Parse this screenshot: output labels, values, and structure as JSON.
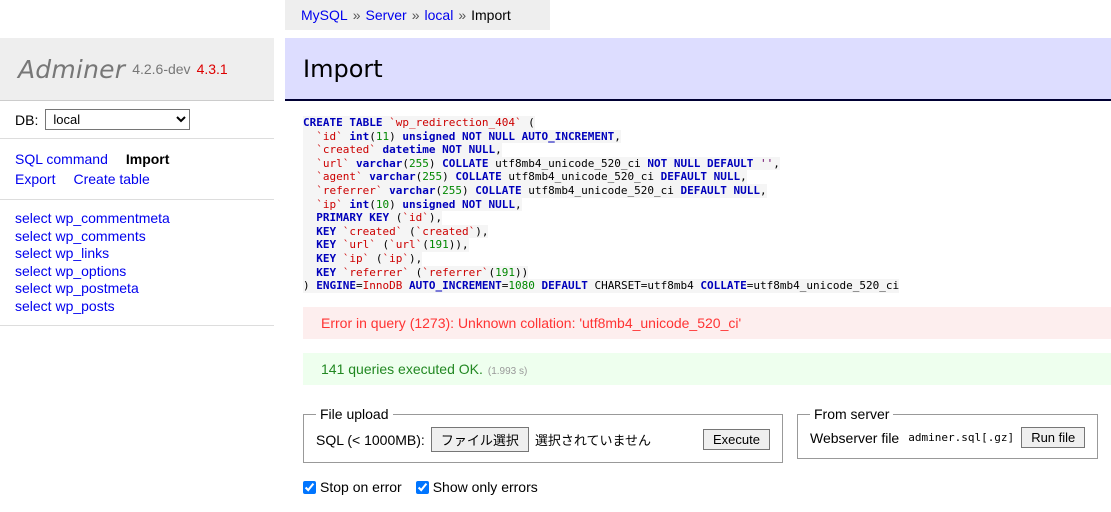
{
  "breadcrumb": {
    "separator": "»",
    "items": [
      {
        "label": "MySQL",
        "link": true
      },
      {
        "label": "Server",
        "link": true
      },
      {
        "label": "local",
        "link": true
      },
      {
        "label": "Import",
        "link": false
      }
    ]
  },
  "sidebar": {
    "logo": {
      "name": "Adminer",
      "version": "4.2.6-dev",
      "new_version": "4.3.1"
    },
    "db": {
      "label": "DB:",
      "selected": "local",
      "options": [
        "local"
      ]
    },
    "nav": {
      "row1": [
        {
          "label": "SQL command",
          "current": false
        },
        {
          "label": "Import",
          "current": true
        }
      ],
      "row2": [
        {
          "label": "Export",
          "current": false
        },
        {
          "label": "Create table",
          "current": false
        }
      ]
    },
    "tables": [
      "select wp_commentmeta",
      "select wp_comments",
      "select wp_links",
      "select wp_options",
      "select wp_postmeta",
      "select wp_posts"
    ]
  },
  "main": {
    "title": "Import",
    "sql": {
      "raw": "CREATE TABLE `wp_redirection_404` (\n  `id` int(11) unsigned NOT NULL AUTO_INCREMENT,\n  `created` datetime NOT NULL,\n  `url` varchar(255) COLLATE utf8mb4_unicode_520_ci NOT NULL DEFAULT '',\n  `agent` varchar(255) COLLATE utf8mb4_unicode_520_ci DEFAULT NULL,\n  `referrer` varchar(255) COLLATE utf8mb4_unicode_520_ci DEFAULT NULL,\n  `ip` int(10) unsigned NOT NULL,\n  PRIMARY KEY (`id`),\n  KEY `created` (`created`),\n  KEY `url` (`url`(191)),\n  KEY `ip` (`ip`),\n  KEY `referrer` (`referrer`(191))\n) ENGINE=InnoDB AUTO_INCREMENT=1080 DEFAULT CHARSET=utf8mb4 COLLATE=utf8mb4_unicode_520_ci",
      "lines": [
        [
          [
            "k",
            "CREATE TABLE"
          ],
          [
            "pl",
            " "
          ],
          [
            "id",
            "`wp_redirection_404`"
          ],
          [
            "pl",
            " ("
          ]
        ],
        [
          [
            "pl",
            "  "
          ],
          [
            "id",
            "`id`"
          ],
          [
            "pl",
            " "
          ],
          [
            "k",
            "int"
          ],
          [
            "pl",
            "("
          ],
          [
            "num",
            "11"
          ],
          [
            "pl",
            ") "
          ],
          [
            "k",
            "unsigned NOT NULL AUTO_INCREMENT"
          ],
          [
            "pl",
            ","
          ]
        ],
        [
          [
            "pl",
            "  "
          ],
          [
            "id",
            "`created`"
          ],
          [
            "pl",
            " "
          ],
          [
            "k",
            "datetime NOT NULL"
          ],
          [
            "pl",
            ","
          ]
        ],
        [
          [
            "pl",
            "  "
          ],
          [
            "id",
            "`url`"
          ],
          [
            "pl",
            " "
          ],
          [
            "k",
            "varchar"
          ],
          [
            "pl",
            "("
          ],
          [
            "num",
            "255"
          ],
          [
            "pl",
            ") "
          ],
          [
            "k",
            "COLLATE"
          ],
          [
            "pl",
            " utf8mb4_unicode_520_ci "
          ],
          [
            "k",
            "NOT NULL DEFAULT"
          ],
          [
            "pl",
            " "
          ],
          [
            "str",
            "''"
          ],
          [
            "pl",
            ","
          ]
        ],
        [
          [
            "pl",
            "  "
          ],
          [
            "id",
            "`agent`"
          ],
          [
            "pl",
            " "
          ],
          [
            "k",
            "varchar"
          ],
          [
            "pl",
            "("
          ],
          [
            "num",
            "255"
          ],
          [
            "pl",
            ") "
          ],
          [
            "k",
            "COLLATE"
          ],
          [
            "pl",
            " utf8mb4_unicode_520_ci "
          ],
          [
            "k",
            "DEFAULT NULL"
          ],
          [
            "pl",
            ","
          ]
        ],
        [
          [
            "pl",
            "  "
          ],
          [
            "id",
            "`referrer`"
          ],
          [
            "pl",
            " "
          ],
          [
            "k",
            "varchar"
          ],
          [
            "pl",
            "("
          ],
          [
            "num",
            "255"
          ],
          [
            "pl",
            ") "
          ],
          [
            "k",
            "COLLATE"
          ],
          [
            "pl",
            " utf8mb4_unicode_520_ci "
          ],
          [
            "k",
            "DEFAULT NULL"
          ],
          [
            "pl",
            ","
          ]
        ],
        [
          [
            "pl",
            "  "
          ],
          [
            "id",
            "`ip`"
          ],
          [
            "pl",
            " "
          ],
          [
            "k",
            "int"
          ],
          [
            "pl",
            "("
          ],
          [
            "num",
            "10"
          ],
          [
            "pl",
            ") "
          ],
          [
            "k",
            "unsigned NOT NULL"
          ],
          [
            "pl",
            ","
          ]
        ],
        [
          [
            "pl",
            "  "
          ],
          [
            "k",
            "PRIMARY KEY"
          ],
          [
            "pl",
            " ("
          ],
          [
            "id",
            "`id`"
          ],
          [
            "pl",
            "),"
          ]
        ],
        [
          [
            "pl",
            "  "
          ],
          [
            "k",
            "KEY"
          ],
          [
            "pl",
            " "
          ],
          [
            "id",
            "`created`"
          ],
          [
            "pl",
            " ("
          ],
          [
            "id",
            "`created`"
          ],
          [
            "pl",
            "),"
          ]
        ],
        [
          [
            "pl",
            "  "
          ],
          [
            "k",
            "KEY"
          ],
          [
            "pl",
            " "
          ],
          [
            "id",
            "`url`"
          ],
          [
            "pl",
            " ("
          ],
          [
            "id",
            "`url`"
          ],
          [
            "pl",
            "("
          ],
          [
            "num",
            "191"
          ],
          [
            "pl",
            ")),"
          ]
        ],
        [
          [
            "pl",
            "  "
          ],
          [
            "k",
            "KEY"
          ],
          [
            "pl",
            " "
          ],
          [
            "id",
            "`ip`"
          ],
          [
            "pl",
            " ("
          ],
          [
            "id",
            "`ip`"
          ],
          [
            "pl",
            "),"
          ]
        ],
        [
          [
            "pl",
            "  "
          ],
          [
            "k",
            "KEY"
          ],
          [
            "pl",
            " "
          ],
          [
            "id",
            "`referrer`"
          ],
          [
            "pl",
            " ("
          ],
          [
            "id",
            "`referrer`"
          ],
          [
            "pl",
            "("
          ],
          [
            "num",
            "191"
          ],
          [
            "pl",
            "))"
          ]
        ],
        [
          [
            "pl",
            ") "
          ],
          [
            "k",
            "ENGINE"
          ],
          [
            "pl",
            "="
          ],
          [
            "id",
            "InnoDB"
          ],
          [
            "pl",
            " "
          ],
          [
            "k",
            "AUTO_INCREMENT"
          ],
          [
            "pl",
            "="
          ],
          [
            "num",
            "1080"
          ],
          [
            "pl",
            " "
          ],
          [
            "k",
            "DEFAULT"
          ],
          [
            "pl",
            " CHARSET=utf8mb4 "
          ],
          [
            "k",
            "COLLATE"
          ],
          [
            "pl",
            "=utf8mb4_unicode_520_ci"
          ]
        ]
      ]
    },
    "error_message": "Error in query (1273): Unknown collation: 'utf8mb4_unicode_520_ci'",
    "success_message": "141 queries executed OK.",
    "success_time": "(1.993 s)",
    "file_upload": {
      "legend": "File upload",
      "label": "SQL (< 1000MB):",
      "browse_button": "ファイル選択",
      "file_status": "選択されていません",
      "execute_button": "Execute"
    },
    "from_server": {
      "legend": "From server",
      "label": "Webserver file",
      "filename": "adminer.sql[.gz]",
      "run_button": "Run file"
    },
    "options": [
      {
        "label": "Stop on error",
        "checked": true
      },
      {
        "label": "Show only errors",
        "checked": true
      }
    ]
  },
  "colors": {
    "header_bg": "#ddddff",
    "sidebar_bg": "#eeeeee",
    "link": "#0000ee",
    "error_text": "#ff3333",
    "error_bg": "#fdeeee",
    "success_text": "#228822",
    "success_bg": "#eeffee",
    "new_version": "#dd0000",
    "sql_keyword": "#0000bb",
    "sql_identifier": "#cc0000",
    "sql_number": "#008800"
  }
}
